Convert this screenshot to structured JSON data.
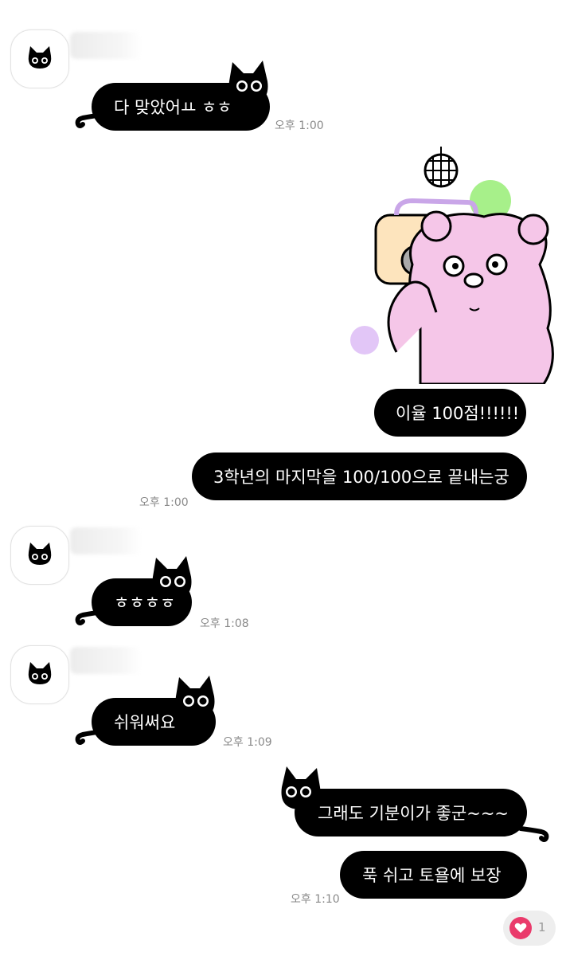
{
  "messages": [
    {
      "sender": "other",
      "text": "다 맞았어ㅛ ㅎㅎ",
      "time": "오후 1:00"
    },
    {
      "sender": "me",
      "type": "sticker",
      "sticker_name": "pink bear with boombox"
    },
    {
      "sender": "me",
      "text": "이율 100점!!!!!!"
    },
    {
      "sender": "me",
      "text": "3학년의 마지막을 100/100으로 끝내는궁",
      "time": "오후 1:00"
    },
    {
      "sender": "other",
      "text": "ㅎㅎㅎㅎ",
      "time": "오후 1:08"
    },
    {
      "sender": "other",
      "text": "쉬워써요",
      "time": "오후 1:09"
    },
    {
      "sender": "me",
      "text": "그래도 기분이가 좋군~~~"
    },
    {
      "sender": "me",
      "text": "푹 쉬고 토욜에 보장",
      "time": "오후 1:10"
    }
  ],
  "reaction": {
    "icon": "heart-icon",
    "count": "1",
    "color": "#ea3a6b"
  },
  "colors": {
    "bubble": "#000000",
    "bubble_text": "#ffffff",
    "time": "#8a8a8a",
    "bear": "#f5c6e8",
    "green_dot": "#a7f08a",
    "purple_dot": "#e2c6f7"
  }
}
